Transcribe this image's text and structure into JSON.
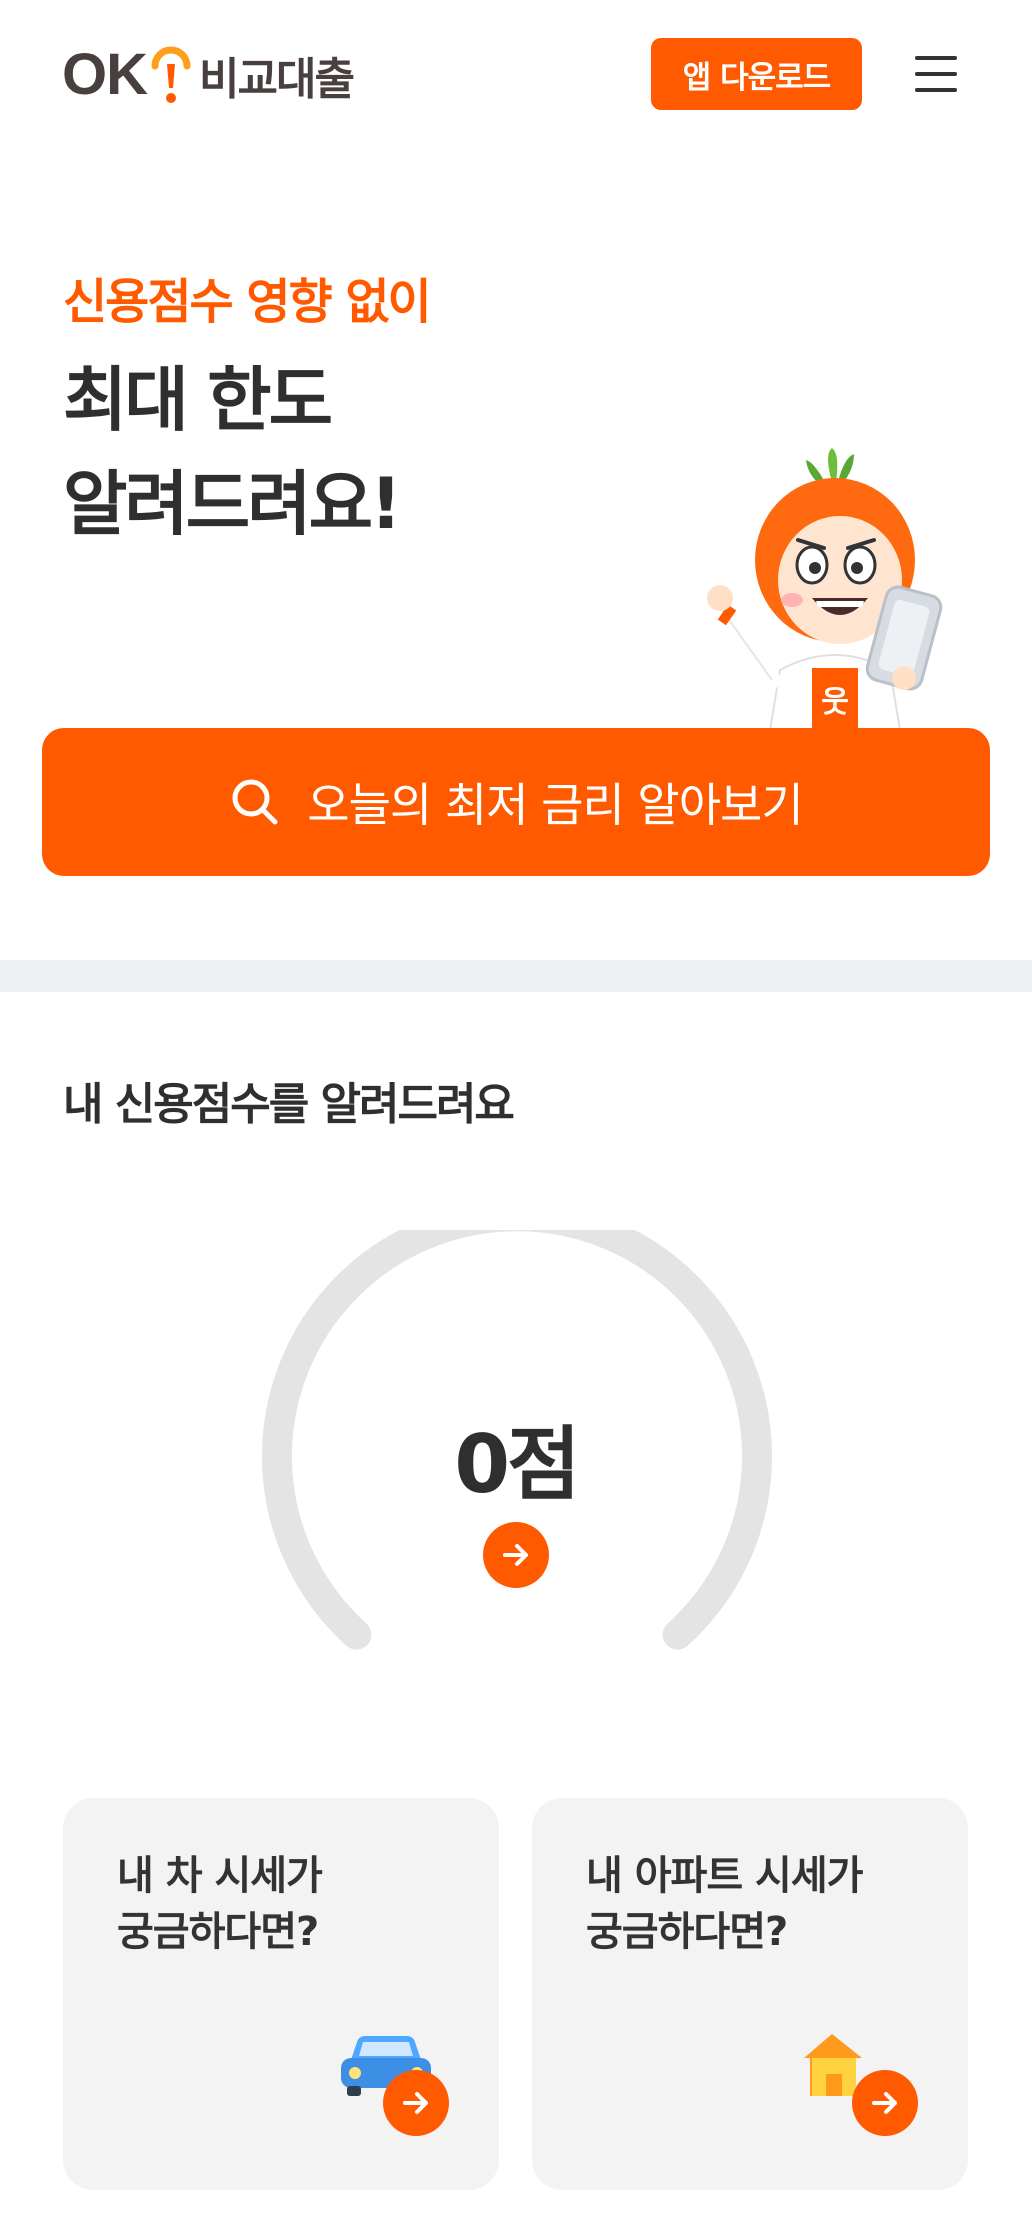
{
  "header": {
    "logo_ok": "OK",
    "logo_name": "비교대출",
    "download_label": "앱 다운로드",
    "menu_icon": "hamburger-menu-icon"
  },
  "hero": {
    "subtitle": "신용점수 영향 없이",
    "title_line1": "최대 한도",
    "title_line2": "알려드려요!",
    "search_label": "오늘의 최저 금리 알아보기",
    "search_icon": "search-icon"
  },
  "score": {
    "section_title": "내 신용점수를 알려드려요",
    "value": "0점",
    "gauge_fill": 0
  },
  "cards": [
    {
      "line1": "내 차 시세가",
      "line2": "궁금하다면?",
      "icon": "car-icon"
    },
    {
      "line1": "내 아파트 시세가",
      "line2": "궁금하다면?",
      "icon": "house-icon"
    }
  ],
  "colors": {
    "accent": "#ff5a00",
    "text_dark": "#2f2f2f",
    "logo_brown": "#4a3f3f",
    "gauge_track": "#e4e4e4",
    "card_bg": "#f3f3f3",
    "divider": "#eef0f2"
  }
}
